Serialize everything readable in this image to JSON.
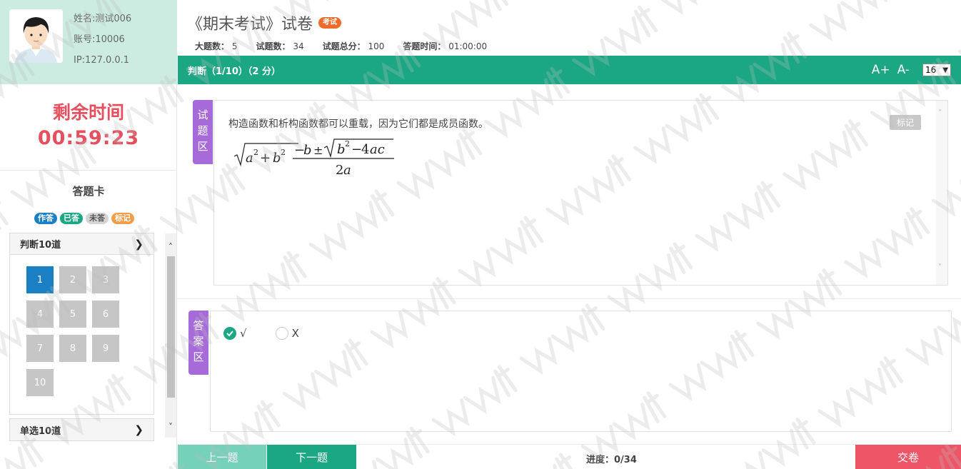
{
  "user": {
    "name": "姓名:测试006",
    "account": "账号:10006",
    "ip": "IP:127.0.0.1"
  },
  "timer": {
    "label": "剩余时间",
    "value": "00:59:23"
  },
  "answer_card": {
    "title": "答题卡",
    "legend": [
      "作答",
      "已答",
      "未答",
      "标记"
    ],
    "groups": [
      {
        "label": "判断10道",
        "items": [
          "1",
          "2",
          "3",
          "4",
          "5",
          "6",
          "7",
          "8",
          "9",
          "10"
        ],
        "current": "1"
      },
      {
        "label": "单选10道"
      }
    ]
  },
  "exam": {
    "title": "《期末考试》试卷",
    "badge": "考试",
    "meta": [
      {
        "label": "大题数：",
        "value": "5"
      },
      {
        "label": "试题数：",
        "value": "34"
      },
      {
        "label": "试题总分：",
        "value": "100"
      },
      {
        "label": "答题时间：",
        "value": "01:00:00"
      }
    ]
  },
  "section_bar": {
    "title": "判断（1/10）（2 分）",
    "font_increase": "A+",
    "font_decrease": "A-",
    "font_size_value": "16"
  },
  "question": {
    "tag": [
      "试",
      "题",
      "区"
    ],
    "text": "构造函数和析构函数都可以重载，因为它们都是成员函数。",
    "mark_label": "标记"
  },
  "answer": {
    "tag": [
      "答",
      "案",
      "区"
    ],
    "options": [
      {
        "label": "√",
        "selected": true
      },
      {
        "label": "X",
        "selected": false
      }
    ]
  },
  "footer": {
    "prev_label": "上一题",
    "next_label": "下一题",
    "progress": "进度：0/34",
    "submit_label": "交卷"
  },
  "colors": {
    "accent": "#1ba784",
    "current": "#1b7fc4",
    "timer": "#e6505e",
    "tag": "#a66bd9",
    "submit": "#ee5566"
  }
}
